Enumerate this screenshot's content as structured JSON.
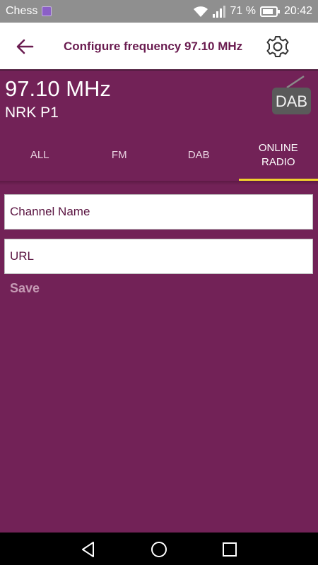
{
  "status_bar": {
    "app_label": "Chess",
    "battery_percent": "71 %",
    "time": "20:42"
  },
  "header": {
    "title": "Configure frequency 97.10 MHz",
    "back_icon": "arrow-left-icon",
    "settings_icon": "gear-icon"
  },
  "station": {
    "frequency": "97.10 MHz",
    "name": "NRK P1",
    "badge": "DAB"
  },
  "tabs": [
    {
      "label": "ALL",
      "active": false
    },
    {
      "label": "FM",
      "active": false
    },
    {
      "label": "DAB",
      "active": false
    },
    {
      "label": "ONLINE RADIO",
      "active": true
    }
  ],
  "form": {
    "channel_name_placeholder": "Channel Name",
    "channel_name_value": "",
    "url_placeholder": "URL",
    "url_value": "",
    "save_label": "Save"
  },
  "colors": {
    "background": "#722257",
    "accent_underline": "#f2d32d",
    "title": "#6a1c50"
  }
}
